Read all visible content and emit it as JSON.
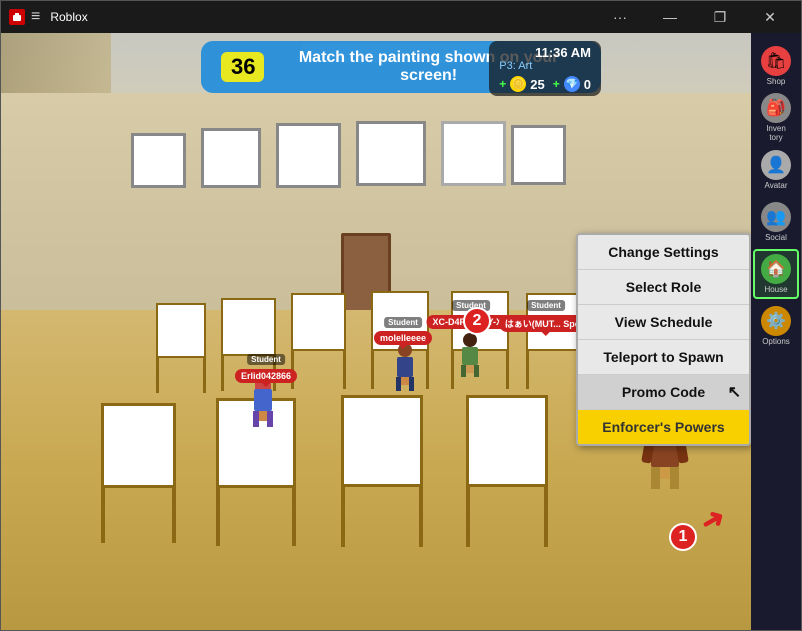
{
  "window": {
    "title": "Roblox",
    "titlebar_icon": "roblox-icon"
  },
  "titlebar": {
    "minimize": "—",
    "maximize": "❐",
    "close": "✕",
    "more": "···"
  },
  "hud": {
    "timer": "36",
    "message": "Match the painting shown on your screen!",
    "time": "11:36 AM",
    "period": "P3: Art",
    "coins_plus": "+",
    "coins_gold": "25",
    "coins_blue": "0"
  },
  "sidebar": {
    "shop_label": "Shop",
    "inventory_label": "Inven\ntory",
    "avatar_label": "Avatar",
    "social_label": "Social",
    "house_label": "House",
    "options_label": "Options"
  },
  "menu": {
    "change_settings": "Change Settings",
    "select_role": "Select Role",
    "view_schedule": "View Schedule",
    "teleport_to_spawn": "Teleport to Spawn",
    "promo_code": "Promo Code",
    "enforcers_powers": "Enforcer's Powers"
  },
  "players": {
    "player1_name": "Erlid042866",
    "player1_role": "Student",
    "player2_name": "molelleeee",
    "player2_role": "Student",
    "player3_name": "XC-D4RK SKY-X (Tomo...",
    "player3_role": "Student",
    "player4_name": "はぁい(MUTTM... Spe...",
    "player4_role": "Student"
  },
  "badges": {
    "badge1": "1",
    "badge2": "2"
  }
}
